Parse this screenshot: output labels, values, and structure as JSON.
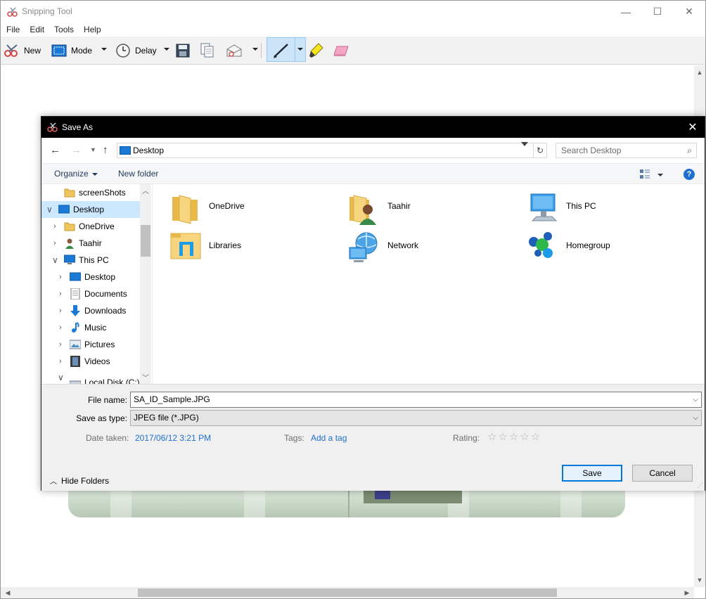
{
  "app": {
    "title": "Snipping Tool",
    "menu": [
      "File",
      "Edit",
      "Tools",
      "Help"
    ],
    "toolbar": {
      "new_label": "New",
      "mode_label": "Mode",
      "delay_label": "Delay"
    }
  },
  "dialog": {
    "title": "Save As",
    "address": {
      "location": "Desktop",
      "search_placeholder": "Search Desktop"
    },
    "commands": {
      "organize": "Organize",
      "new_folder": "New folder"
    },
    "nav_tree": [
      {
        "label": "screenShots",
        "icon": "folder-icon"
      },
      {
        "label": "Desktop",
        "icon": "desktop-icon",
        "selected": true,
        "expanded": true
      },
      {
        "label": "OneDrive",
        "icon": "folder-icon"
      },
      {
        "label": "Taahir",
        "icon": "user-icon"
      },
      {
        "label": "This PC",
        "icon": "computer-icon",
        "expanded": true
      },
      {
        "label": "Desktop",
        "icon": "desktop-icon"
      },
      {
        "label": "Documents",
        "icon": "document-icon"
      },
      {
        "label": "Downloads",
        "icon": "download-icon"
      },
      {
        "label": "Music",
        "icon": "music-icon"
      },
      {
        "label": "Pictures",
        "icon": "picture-icon"
      },
      {
        "label": "Videos",
        "icon": "video-icon"
      },
      {
        "label": "Local Disk (C:)",
        "icon": "drive-icon"
      }
    ],
    "files": [
      {
        "label": "OneDrive",
        "icon": "folder-icon"
      },
      {
        "label": "Taahir",
        "icon": "user-folder-icon"
      },
      {
        "label": "This PC",
        "icon": "computer-icon"
      },
      {
        "label": "Libraries",
        "icon": "libraries-icon"
      },
      {
        "label": "Network",
        "icon": "network-icon"
      },
      {
        "label": "Homegroup",
        "icon": "homegroup-icon"
      }
    ],
    "form": {
      "file_name_label": "File name:",
      "file_name_value": "SA_ID_Sample.JPG",
      "save_type_label": "Save as type:",
      "save_type_value": "JPEG file (*.JPG)",
      "date_taken_label": "Date taken:",
      "date_taken_value": "2017/06/12 3:21 PM",
      "tags_label": "Tags:",
      "tags_value": "Add a tag",
      "rating_label": "Rating:",
      "rating_stars": "☆☆☆☆☆",
      "hide_folders": "Hide Folders",
      "save_button": "Save",
      "cancel_button": "Cancel"
    }
  },
  "colors": {
    "accent": "#0078d7",
    "link": "#1e6fd0",
    "selection": "#cce8ff",
    "pen_active": "#cce4f7",
    "folder": "#f0c75e"
  }
}
